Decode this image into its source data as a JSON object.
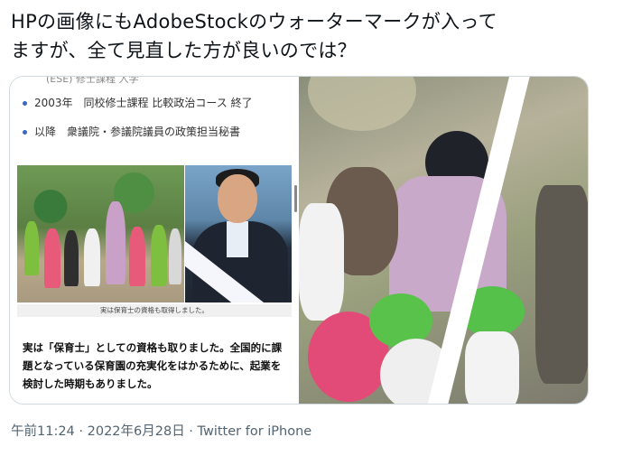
{
  "tweet": {
    "line1": "HPの画像にもAdobeStockのウォーターマークが入って",
    "line2": "ますが、全て見直した方が良いのでは？"
  },
  "media": {
    "left": {
      "cut_text": "(ESE) 修士課程 入学",
      "bullets": [
        "2003年　同校修士課程 比較政治コース 終了",
        "以降　衆議院・参議院議員の政策担当秘書"
      ],
      "photo_caption": "実は保育士の資格も取得しました。",
      "body_text": "実は「保育士」としての資格も取りました。全国的に課題となっている保育園の充実化をはかるために、起業を検討した時期もありました。",
      "colors": {
        "bullet": "#3a66c4"
      }
    }
  },
  "meta": {
    "timestamp": "午前11:24 · 2022年6月28日 · Twitter for iPhone"
  }
}
